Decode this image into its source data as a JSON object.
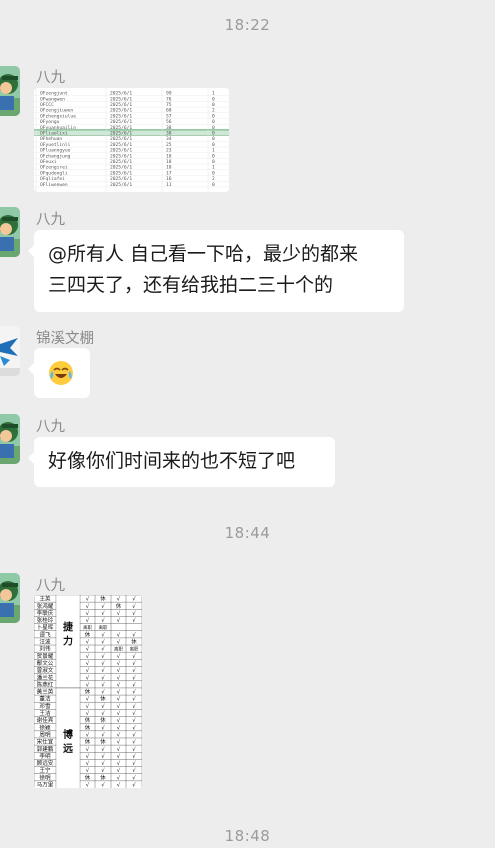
{
  "timestamps": [
    "18:22",
    "18:44",
    "18:48"
  ],
  "messages": [
    {
      "sender": "八九",
      "type": "image",
      "image": "attendance-spreadsheet-screenshot"
    },
    {
      "sender": "八九",
      "type": "text",
      "lines": [
        "@所有人  自己看一下哈，最少的都来",
        "三四天了，还有给我拍二三十个的"
      ]
    },
    {
      "sender": "锦溪文棚",
      "type": "emoji",
      "emoji": "crying-laughing-face-icon"
    },
    {
      "sender": "八九",
      "type": "text",
      "lines": [
        "好像你们时间来的也不短了吧"
      ]
    },
    {
      "sender": "八九",
      "type": "image",
      "image": "attendance-checklist-sheet"
    }
  ],
  "image1": {
    "rows": [
      [
        "OFzengjunt",
        "2025/6/1",
        "99",
        "1"
      ],
      [
        "OFwangwen",
        "2025/6/1",
        "76",
        "0"
      ],
      [
        "OFCCC",
        "2025/6/1",
        "75",
        "0"
      ],
      [
        "OFzengjiuwen",
        "2025/6/1",
        "60",
        "2"
      ],
      [
        "OFzhengxiulue",
        "2025/6/1",
        "57",
        "0"
      ],
      [
        "OFyongu",
        "2025/6/1",
        "56",
        "0"
      ],
      [
        "OFyuanhuailin",
        "2025/6/1",
        "38",
        "0"
      ],
      [
        "OFliaolixi",
        "2025/6/1",
        "38",
        "0"
      ],
      [
        "OFhehuan",
        "2025/6/1",
        "34",
        "0"
      ],
      [
        "OFyuetlinli",
        "2025/6/1",
        "25",
        "0"
      ],
      [
        "OFluanngyue",
        "2025/6/1",
        "23",
        "1"
      ],
      [
        "OFzhangjung",
        "2025/6/1",
        "18",
        "0"
      ],
      [
        "OFeuxi",
        "2025/6/1",
        "18",
        "0"
      ],
      [
        "OFzengirei",
        "2025/6/1",
        "18",
        "1"
      ],
      [
        "OFqudongli",
        "2025/6/1",
        "17",
        "0"
      ],
      [
        "OFqliafei",
        "2025/6/1",
        "16",
        "2"
      ],
      [
        "OFliwenwen",
        "2025/6/1",
        "11",
        "0"
      ]
    ],
    "highlight_row": 7
  },
  "image2": {
    "group1": "捷力",
    "group2": "博远",
    "names": [
      "王英",
      "张鸿耀",
      "李联庆",
      "张桂玲",
      "卜星晖",
      "谭飞",
      "汪波",
      "刘伟",
      "贺景耀",
      "鄢文公",
      "曾淑文",
      "潘兰花",
      "陈燕红",
      "黄兰英",
      "董洁",
      "邓雪",
      "王洁",
      "谢佳宾",
      "徐颖",
      "周明",
      "宋仕宜",
      "郭建鹏",
      "李明",
      "顾远安",
      "王宁",
      "徐明",
      "马万里"
    ],
    "marks": [
      [
        "√",
        "休",
        "√",
        "√"
      ],
      [
        "√",
        "√",
        "休",
        "√"
      ],
      [
        "√",
        "√",
        "√",
        "√"
      ],
      [
        "√",
        "√",
        "√",
        "√"
      ],
      [
        "离职",
        "离职",
        "",
        ""
      ],
      [
        "休",
        "√",
        "√",
        "√"
      ],
      [
        "√",
        "√",
        "√",
        "休"
      ],
      [
        "√",
        "√",
        "离职",
        "离职"
      ],
      [
        "√",
        "√",
        "√",
        "√"
      ],
      [
        "√",
        "√",
        "√",
        "√"
      ],
      [
        "√",
        "√",
        "√",
        "√"
      ],
      [
        "√",
        "√",
        "√",
        "√"
      ],
      [
        "√",
        "√",
        "√",
        "√"
      ],
      [
        "休",
        "√",
        "√",
        "√"
      ],
      [
        "√",
        "休",
        "√",
        "√"
      ],
      [
        "√",
        "√",
        "√",
        "√"
      ],
      [
        "√",
        "√",
        "√",
        "√"
      ],
      [
        "休",
        "休",
        "√",
        "√"
      ],
      [
        "休",
        "√",
        "√",
        "√"
      ],
      [
        "√",
        "√",
        "√",
        "√"
      ],
      [
        "休",
        "休",
        "√",
        "√"
      ],
      [
        "√",
        "√",
        "√",
        "√"
      ],
      [
        "√",
        "√",
        "√",
        "√"
      ],
      [
        "√",
        "√",
        "√",
        "√"
      ],
      [
        "√",
        "√",
        "√",
        "√"
      ],
      [
        "休",
        "休",
        "√",
        "√"
      ],
      [
        "√",
        "√",
        "√",
        "√"
      ]
    ]
  }
}
